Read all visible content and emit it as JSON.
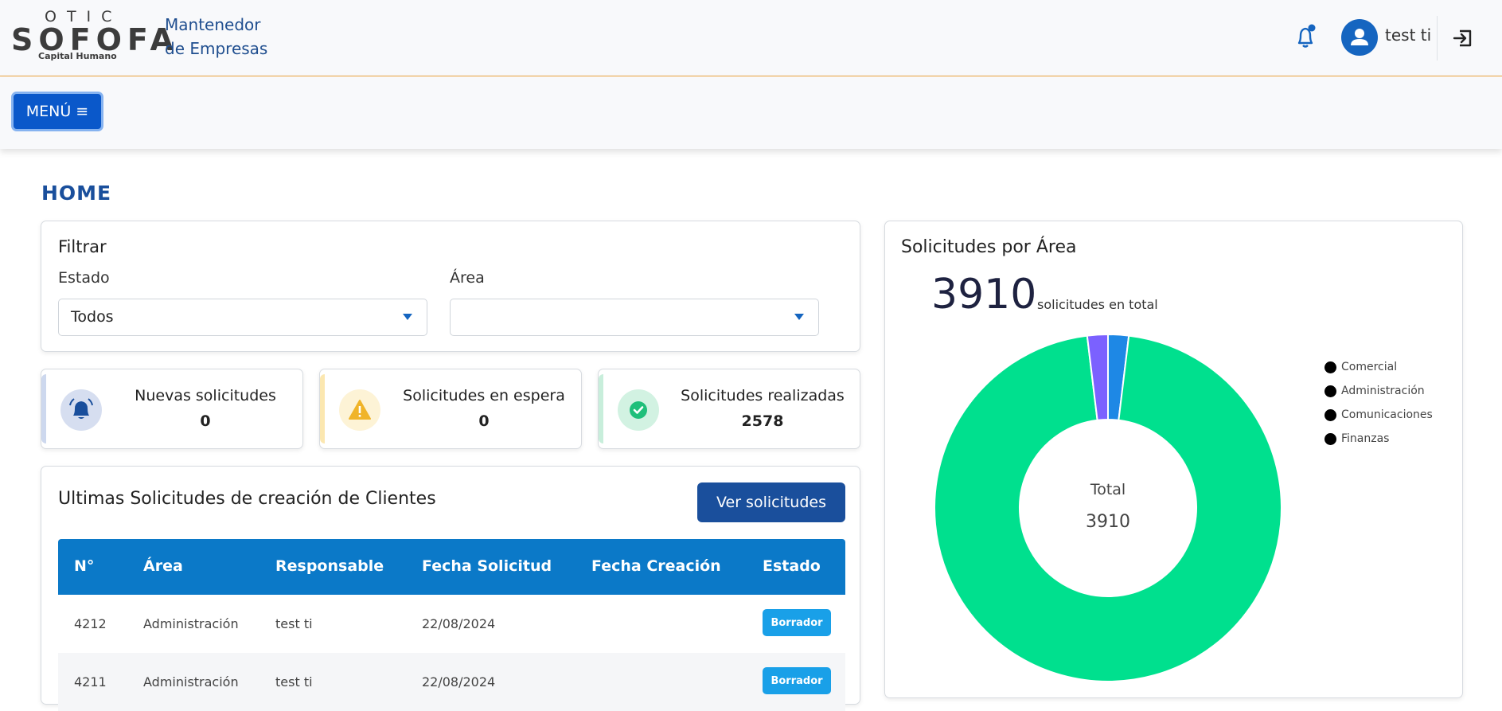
{
  "brand": {
    "top": "OTIC",
    "main": "SOFOFA",
    "sub": "Capital Humano"
  },
  "app": {
    "title_line1": "Mantenedor",
    "title_line2": "de Empresas"
  },
  "user": {
    "name": "test ti"
  },
  "toolbar": {
    "menu_label": "MENÚ ≡"
  },
  "page": {
    "title": "HOME"
  },
  "filter": {
    "title": "Filtrar",
    "estado_label": "Estado",
    "estado_value": "Todos",
    "area_label": "Área",
    "area_value": ""
  },
  "stats": [
    {
      "label": "Nuevas solicitudes",
      "value": "0",
      "icon": "bell-icon",
      "color": "#1a4f9c",
      "bg": "#d6def0"
    },
    {
      "label": "Solicitudes en espera",
      "value": "0",
      "icon": "warning-icon",
      "color": "#f0b429",
      "bg": "#fdf3d6"
    },
    {
      "label": "Solicitudes realizadas",
      "value": "2578",
      "icon": "check-icon",
      "color": "#1fbf7a",
      "bg": "#d2f2e2"
    }
  ],
  "list": {
    "title": "Ultimas Solicitudes de creación de Clientes",
    "button": "Ver solicitudes",
    "columns": [
      "N°",
      "Área",
      "Responsable",
      "Fecha Solicitud",
      "Fecha Creación",
      "Estado"
    ],
    "rows": [
      {
        "n": "4212",
        "area": "Administración",
        "responsable": "test ti",
        "fecha_solicitud": "22/08/2024",
        "fecha_creacion": "",
        "estado": "Borrador"
      },
      {
        "n": "4211",
        "area": "Administración",
        "responsable": "test ti",
        "fecha_solicitud": "22/08/2024",
        "fecha_creacion": "",
        "estado": "Borrador"
      }
    ]
  },
  "chart_panel": {
    "title": "Solicitudes por Área",
    "total": "3910",
    "total_caption": "solicitudes en total",
    "center_label": "Total",
    "center_value": "3910"
  },
  "chart_data": {
    "type": "pie",
    "categories": [
      "Comercial",
      "Administración",
      "Comunicaciones",
      "Finanzas"
    ],
    "values": [
      75,
      3760,
      0,
      75
    ],
    "colors": [
      "#1e88e5",
      "#00e08e",
      "#f0b11e",
      "#7b61ff"
    ],
    "legend_position": "right",
    "donut": true
  },
  "colors": {
    "primary": "#0a58ca",
    "title_blue": "#1a4f9c",
    "table_header": "#0b79c8",
    "badge": "#19a0e8",
    "header_border": "#e8a13c"
  }
}
